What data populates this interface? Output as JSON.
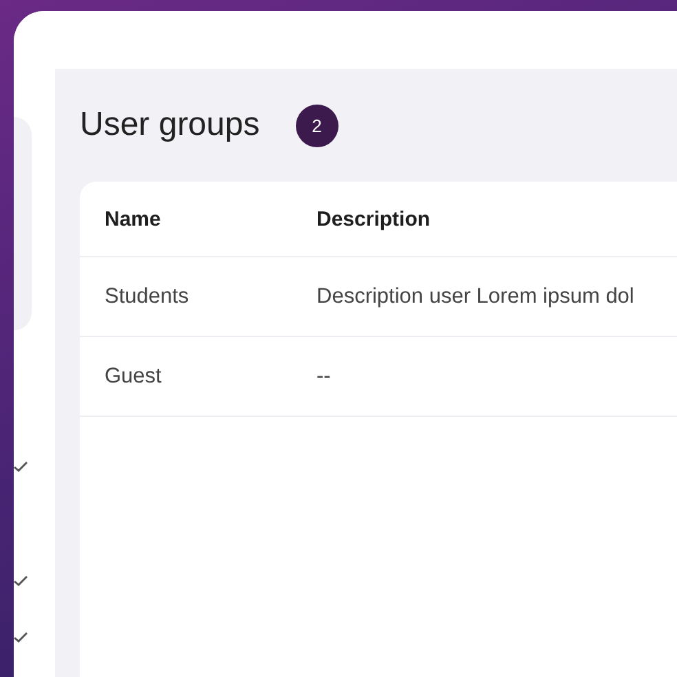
{
  "page": {
    "title": "User groups",
    "count": "2"
  },
  "sidebar": {
    "checks": [
      {
        "checked": true
      },
      {
        "checked": true
      },
      {
        "checked": true
      }
    ]
  },
  "table": {
    "columns": [
      "Name",
      "Description"
    ],
    "rows": [
      {
        "name": "Students",
        "description": "Description user Lorem ipsum dol"
      },
      {
        "name": "Guest",
        "description": "--"
      }
    ]
  }
}
